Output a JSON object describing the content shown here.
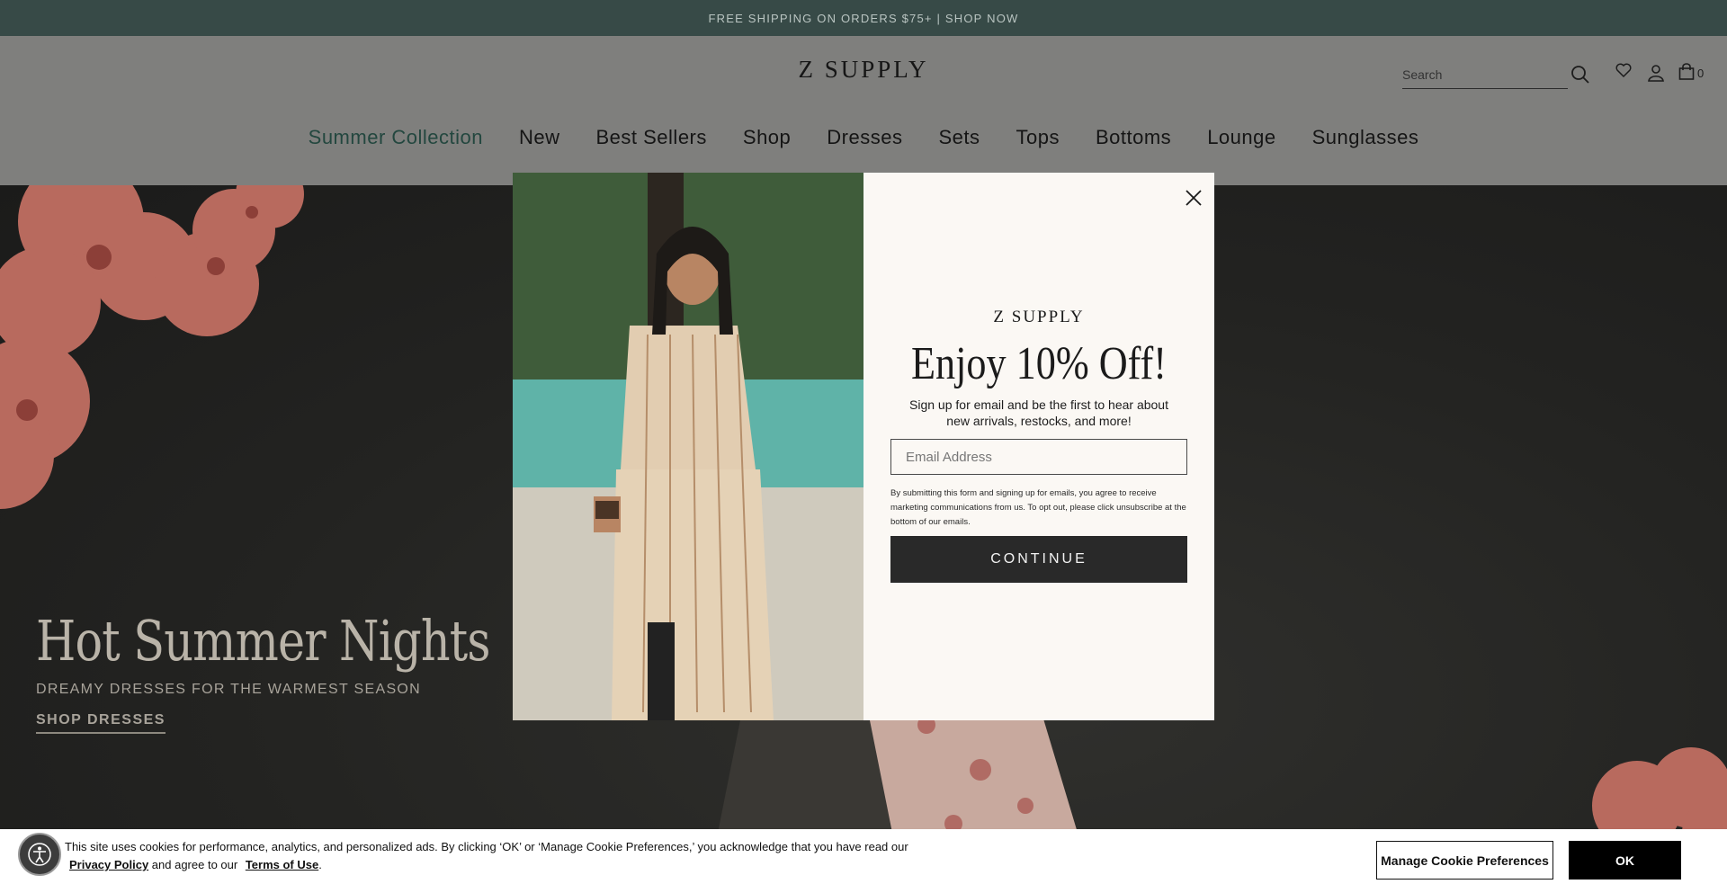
{
  "announcement": {
    "text": "FREE SHIPPING ON ORDERS $75+ | SHOP NOW"
  },
  "header": {
    "logo": "Z SUPPLY",
    "search_placeholder": "Search",
    "cart_count": "0",
    "icons": [
      "search-icon",
      "heart-icon",
      "user-icon",
      "bag-icon"
    ]
  },
  "nav": {
    "items": [
      {
        "label": "Summer Collection"
      },
      {
        "label": "New"
      },
      {
        "label": "Best Sellers"
      },
      {
        "label": "Shop"
      },
      {
        "label": "Dresses"
      },
      {
        "label": "Sets"
      },
      {
        "label": "Tops"
      },
      {
        "label": "Bottoms"
      },
      {
        "label": "Lounge"
      },
      {
        "label": "Sunglasses"
      }
    ]
  },
  "hero": {
    "title": "Hot Summer Nights",
    "subtitle": "DREAMY DRESSES FOR THE WARMEST SEASON",
    "cta": "SHOP DRESSES"
  },
  "modal": {
    "logo": "Z SUPPLY",
    "headline": "Enjoy 10% Off!",
    "body": "Sign up for email and be the first to hear about new arrivals, restocks, and more!",
    "email_placeholder": "Email Address",
    "legal": "By submitting this form and signing up for emails, you agree to receive marketing communications from us. To opt out, please click unsubscribe at the bottom of our emails.",
    "cta": "CONTINUE"
  },
  "cookie": {
    "text": "This site uses cookies for performance, analytics, and personalized ads. By clicking ‘OK’ or ‘Manage Cookie Preferences,’ you acknowledge that you have read our",
    "privacy_link": "Privacy Policy",
    "middle": "and agree to our",
    "terms_link": "Terms of Use",
    "end": ".",
    "manage_button": "Manage Cookie Preferences",
    "ok_button": "OK"
  },
  "colors": {
    "announcement_bg": "#374a47",
    "accent_green": "#23473f",
    "modal_bg": "#fbf8f4",
    "cta_bg": "#292929"
  }
}
